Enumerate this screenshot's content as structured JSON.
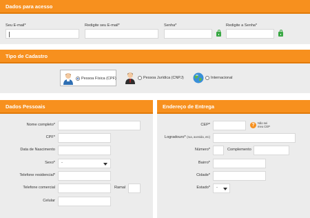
{
  "acesso": {
    "title": "Dados para acesso",
    "email_label": "Seu E-mail*",
    "email_confirm_label": "Redigite seu E-mail*",
    "senha_label": "Senha*",
    "senha_confirm_label": "Redigite a Senha*"
  },
  "cadastro": {
    "title": "Tipo de Cadastro",
    "options": [
      {
        "label": "Pessoa Física (CPF)",
        "selected": true,
        "icon": "person-icon"
      },
      {
        "label": "Pessoa Jurídica (CNPJ)",
        "selected": false,
        "icon": "businessman-icon"
      },
      {
        "label": "Internacional",
        "selected": false,
        "icon": "globe-icon"
      }
    ]
  },
  "pessoais": {
    "title": "Dados Pessoais",
    "nome_label": "Nome completo*",
    "cpf_label": "CPF*",
    "nascimento_label": "Data de Nascimento",
    "sexo_label": "Sexo*",
    "sexo_value": "-",
    "tel_res_label": "Telefone residencial*",
    "tel_com_label": "Telefone comercial",
    "ramal_label": "Ramal",
    "celular_label": "Celular"
  },
  "entrega": {
    "title": "Endereço de Entrega",
    "cep_label": "CEP*",
    "cep_help_line1": "Não sei",
    "cep_help_line2": "meu CEP",
    "logradouro_label": "Logradouro*",
    "logradouro_hint": "(rua, avenida, etc)",
    "numero_label": "Número*",
    "complemento_label": "Complemento",
    "bairro_label": "Bairro*",
    "cidade_label": "Cidade*",
    "estado_label": "Estado*",
    "estado_value": "-"
  },
  "colors": {
    "accent": "#f7901e",
    "panel": "#ececec",
    "lock": "#3aa845"
  }
}
